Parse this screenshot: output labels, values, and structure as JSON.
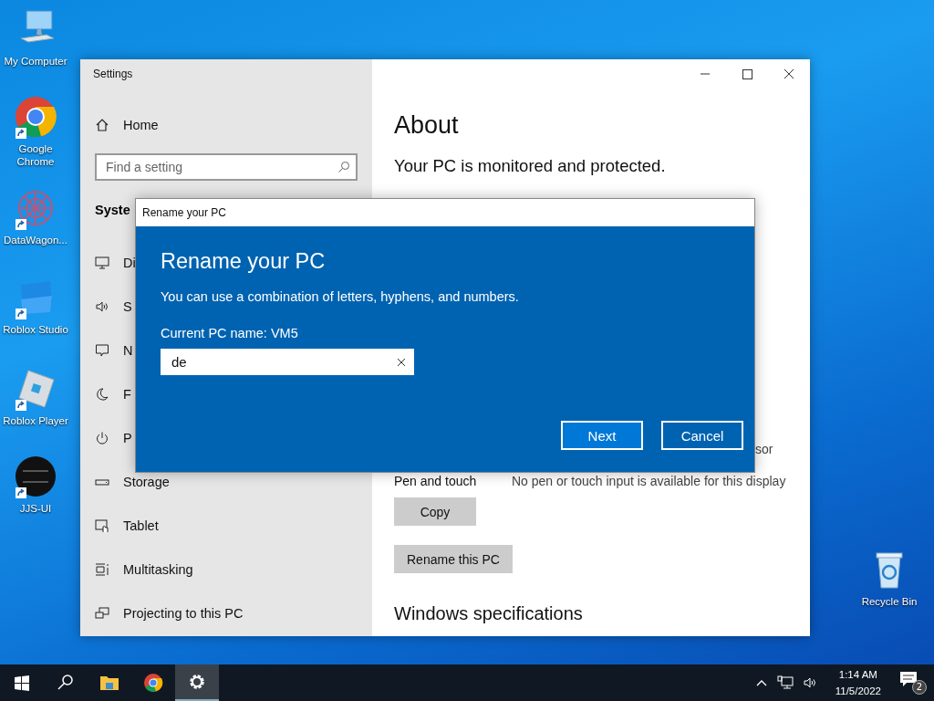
{
  "desktop_icons": [
    {
      "kind": "computer",
      "label": "My Computer",
      "shortcut": false
    },
    {
      "kind": "chrome",
      "label": "Google Chrome",
      "shortcut": true
    },
    {
      "kind": "datawagon",
      "label": "DataWagon...",
      "shortcut": true
    },
    {
      "kind": "studio",
      "label": "Roblox Studio",
      "shortcut": true
    },
    {
      "kind": "player",
      "label": "Roblox Player",
      "shortcut": true
    },
    {
      "kind": "jjs",
      "label": "JJS-UI",
      "shortcut": true
    },
    {
      "kind": "recycle",
      "label": "Recycle Bin",
      "shortcut": false
    }
  ],
  "settings": {
    "title": "Settings",
    "sidebar": {
      "home": "Home",
      "search": {
        "placeholder": "Find a setting"
      },
      "section": "Syste",
      "items": [
        {
          "label": "Di"
        },
        {
          "label": "S"
        },
        {
          "label": "N"
        },
        {
          "label": "F"
        },
        {
          "label": "P"
        },
        {
          "label": "Storage"
        },
        {
          "label": "Tablet"
        },
        {
          "label": "Multitasking"
        },
        {
          "label": "Projecting to this PC"
        }
      ]
    },
    "about": {
      "heading": "About",
      "status": "Your PC is monitored and protected.",
      "fragments": [
        "sor"
      ],
      "pen_row": {
        "label": "Pen and touch",
        "value": "No pen or touch input is available for this display"
      },
      "buttons": [
        "Copy",
        "Rename this PC"
      ],
      "section": "Windows specifications"
    }
  },
  "dialog": {
    "title": "Rename your PC",
    "heading": "Rename your PC",
    "hint": "You can use a combination of letters, hyphens, and numbers.",
    "current": "Current PC name: VM5",
    "input": {
      "value": "de"
    },
    "buttons": [
      {
        "label": "Next",
        "kind": "primary"
      },
      {
        "label": "Cancel",
        "kind": "secondary"
      }
    ]
  },
  "taskbar": {
    "items": [
      {
        "kind": "start",
        "selected": false
      },
      {
        "kind": "search",
        "selected": false
      },
      {
        "kind": "explorer",
        "selected": false
      },
      {
        "kind": "chrome",
        "selected": false
      },
      {
        "kind": "settings",
        "selected": true
      }
    ],
    "time": "1:14 AM",
    "date": "11/5/2022",
    "notifications": "2"
  }
}
